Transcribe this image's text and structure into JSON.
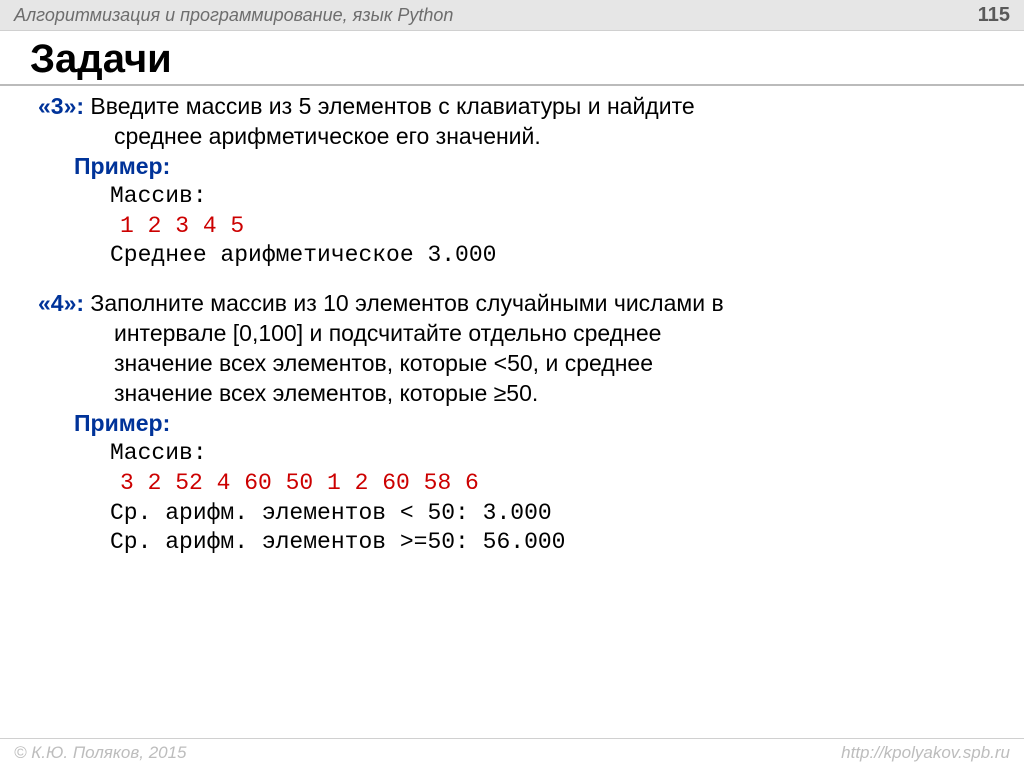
{
  "header": {
    "course": "Алгоритмизация и программирование, язык Python",
    "page": "115"
  },
  "title": "Задачи",
  "tasks": {
    "t3": {
      "label": "«3»:",
      "text_l1": " Введите массив из 5 элементов с клавиатуры и найдите",
      "text_l2": "среднее арифметическое его значений.",
      "example_label": "Пример:",
      "mono1": "Массив:",
      "mono2": "1 2 3 4 5",
      "mono3": "Среднее арифметическое 3.000"
    },
    "t4": {
      "label": "«4»:",
      "text_l1": " Заполните массив из 10 элементов случайными числами в",
      "text_l2": "интервале [0,100] и подсчитайте отдельно среднее",
      "text_l3": "значение всех элементов, которые <50, и среднее",
      "text_l4": "значение всех элементов, которые ≥50.",
      "example_label": "Пример:",
      "mono1": "Массив:",
      "mono2": "3 2 52 4 60 50 1 2 60 58 6",
      "mono3": "Ср. арифм. элементов < 50: 3.000",
      "mono4": "Ср. арифм. элементов >=50: 56.000"
    }
  },
  "footer": {
    "left": "© К.Ю. Поляков, 2015",
    "right": "http://kpolyakov.spb.ru"
  }
}
